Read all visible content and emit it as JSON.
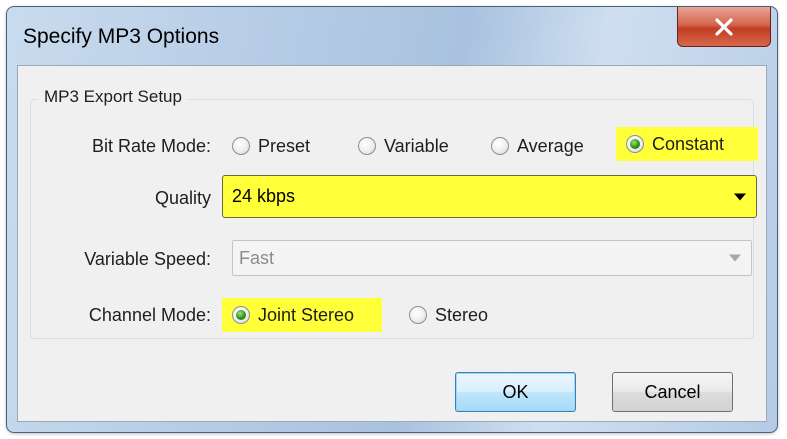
{
  "dialog": {
    "title": "Specify MP3 Options",
    "close_label": "X"
  },
  "group": {
    "title": "MP3 Export Setup"
  },
  "bit_rate_mode": {
    "label": "Bit Rate Mode:",
    "options": [
      "Preset",
      "Variable",
      "Average",
      "Constant"
    ],
    "selected": "Constant"
  },
  "quality": {
    "label": "Quality",
    "value": "24 kbps"
  },
  "variable_speed": {
    "label": "Variable Speed:",
    "value": "Fast",
    "enabled": false
  },
  "channel_mode": {
    "label": "Channel Mode:",
    "options": [
      "Joint Stereo",
      "Stereo"
    ],
    "selected": "Joint Stereo"
  },
  "buttons": {
    "ok": "OK",
    "cancel": "Cancel"
  },
  "colors": {
    "highlight": "#ffff3a",
    "radio_selected": "#2f8f18",
    "close_button": "#c23d22",
    "default_button_border": "#3c7fb1"
  },
  "icons": {
    "close": "close-x-icon",
    "dropdown": "chevron-down-icon"
  }
}
